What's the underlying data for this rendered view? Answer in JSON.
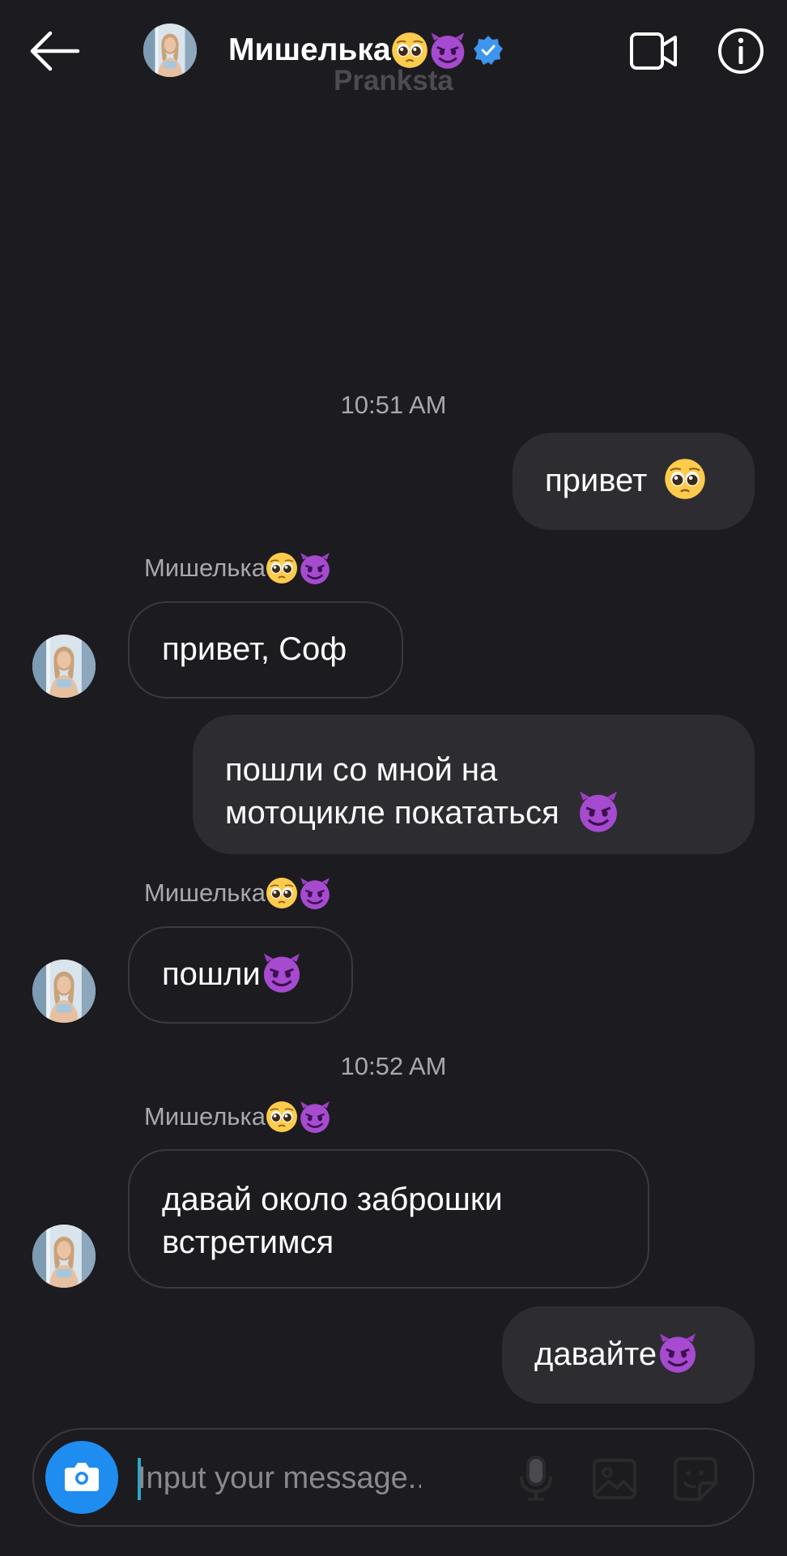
{
  "header": {
    "name": "Мишелька",
    "name_emojis": [
      "pleading-face-icon",
      "smiling-devil-icon"
    ],
    "verified": true,
    "subtitle": "Pranksta"
  },
  "icons": {
    "back": "back-arrow-icon",
    "video": "video-call-icon",
    "info": "info-icon",
    "camera": "camera-icon",
    "mic": "microphone-icon",
    "gallery": "gallery-icon",
    "sticker": "sticker-icon"
  },
  "colors": {
    "background": "#1c1b1f",
    "outgoing_bubble": "#2d2c31",
    "incoming_border": "#3a393e",
    "muted_text": "#a9a8ad",
    "accent_blue": "#1f8df0",
    "verified_blue": "#3d95ef"
  },
  "messages": [
    {
      "type": "timestamp",
      "text": "10:51 AM"
    },
    {
      "type": "outgoing",
      "text": "привет",
      "emoji": "pleading-face-icon"
    },
    {
      "type": "sender",
      "text": "Мишелька"
    },
    {
      "type": "incoming",
      "text": "привет, Соф"
    },
    {
      "type": "outgoing",
      "line1": "пошли со мной на",
      "line2": "мотоцикле покататься",
      "emoji": "smiling-devil-icon"
    },
    {
      "type": "sender",
      "text": "Мишелька"
    },
    {
      "type": "incoming",
      "text": "пошли",
      "emoji": "smiling-devil-icon"
    },
    {
      "type": "timestamp",
      "text": "10:52 AM"
    },
    {
      "type": "sender",
      "text": "Мишелька"
    },
    {
      "type": "incoming",
      "line1": "давай около заброшки",
      "line2": "встретимся"
    },
    {
      "type": "outgoing",
      "text": "давайте",
      "emoji": "smiling-devil-icon"
    }
  ],
  "composer": {
    "placeholder": "Input your message..."
  }
}
